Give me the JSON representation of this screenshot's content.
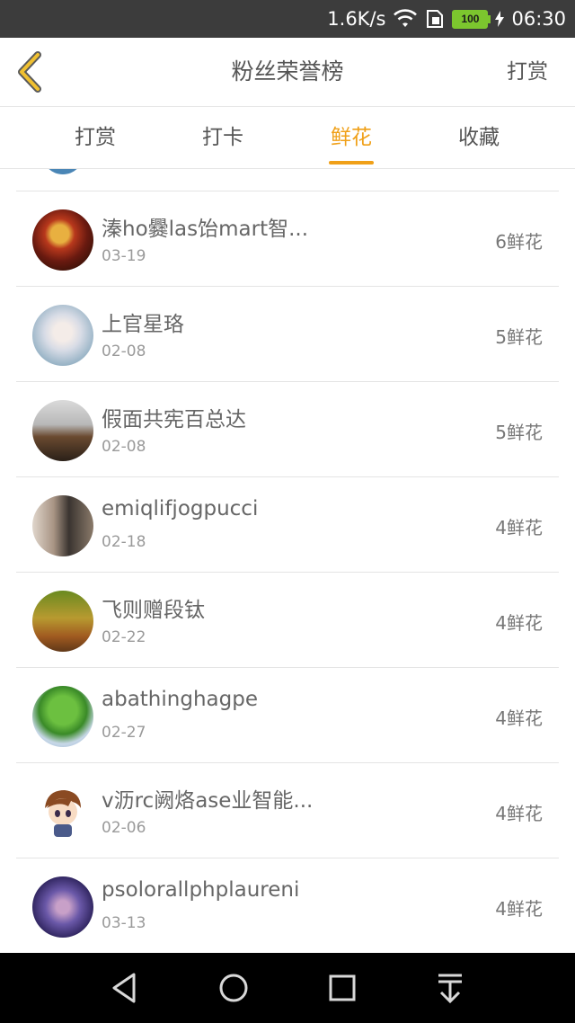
{
  "status_bar": {
    "speed": "1.6K/s",
    "battery": "100",
    "time": "06:30"
  },
  "nav": {
    "title": "粉丝荣誉榜",
    "action": "打赏"
  },
  "tabs": [
    {
      "label": "打赏",
      "active": false
    },
    {
      "label": "打卡",
      "active": false
    },
    {
      "label": "鲜花",
      "active": true
    },
    {
      "label": "收藏",
      "active": false
    }
  ],
  "colors": {
    "accent": "#f0a018",
    "status_bar_bg": "#3c3c3c",
    "battery_green": "#7cc62e"
  },
  "fans": [
    {
      "name": "溱ho爨las饴mart智...",
      "date": "03-19",
      "count": "6鲜花"
    },
    {
      "name": "上官星珞",
      "date": "02-08",
      "count": "5鲜花"
    },
    {
      "name": "假面共宪百总达",
      "date": "02-08",
      "count": "5鲜花"
    },
    {
      "name": "emiqlifjogpucci",
      "date": "02-18",
      "count": "4鲜花"
    },
    {
      "name": "飞则赠段钛",
      "date": "02-22",
      "count": "4鲜花"
    },
    {
      "name": "abathinghagpe",
      "date": "02-27",
      "count": "4鲜花"
    },
    {
      "name": "v沥rc阙烙ase业智能...",
      "date": "02-06",
      "count": "4鲜花"
    },
    {
      "name": "psolorallphplaureni",
      "date": "03-13",
      "count": "4鲜花"
    }
  ],
  "icons": {
    "back": "chevron-left-icon",
    "wifi": "wifi-icon",
    "sim": "sim-icon",
    "charging": "bolt-icon",
    "sys_back": "triangle-back-icon",
    "sys_home": "circle-home-icon",
    "sys_recent": "square-recent-icon",
    "sys_notif": "pull-down-icon"
  }
}
